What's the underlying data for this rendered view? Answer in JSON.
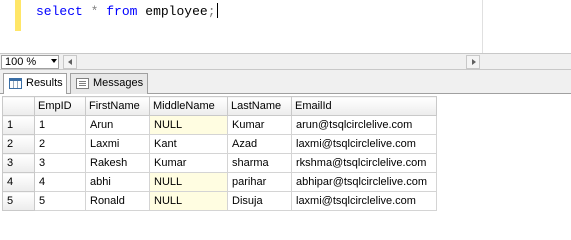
{
  "editor": {
    "tokens": {
      "select": "select",
      "star": "*",
      "from": "from",
      "table": "employee",
      "semicolon": ";"
    }
  },
  "zoom": {
    "value": "100 %"
  },
  "tabs": [
    {
      "label": "Results",
      "icon": "grid-icon",
      "active": true
    },
    {
      "label": "Messages",
      "icon": "messages-icon",
      "active": false
    }
  ],
  "grid": {
    "columns": [
      "EmpID",
      "FirstName",
      "MiddleName",
      "LastName",
      "EmailId"
    ],
    "rows": [
      {
        "n": "1",
        "EmpID": "1",
        "FirstName": "Arun",
        "MiddleName": "NULL",
        "LastName": "Kumar",
        "EmailId": "arun@tsqlcirclelive.com"
      },
      {
        "n": "2",
        "EmpID": "2",
        "FirstName": "Laxmi",
        "MiddleName": "Kant",
        "LastName": "Azad",
        "EmailId": "laxmi@tsqlcirclelive.com"
      },
      {
        "n": "3",
        "EmpID": "3",
        "FirstName": "Rakesh",
        "MiddleName": "Kumar",
        "LastName": "sharma",
        "EmailId": "rkshma@tsqlcirclelive.com"
      },
      {
        "n": "4",
        "EmpID": "4",
        "FirstName": "abhi",
        "MiddleName": "NULL",
        "LastName": "parihar",
        "EmailId": "abhipar@tsqlcirclelive.com"
      },
      {
        "n": "5",
        "EmpID": "5",
        "FirstName": "Ronald",
        "MiddleName": "NULL",
        "LastName": "Disuja",
        "EmailId": "laxmi@tsqlcirclelive.com"
      }
    ]
  },
  "colors": {
    "keyword": "#0000ff",
    "operator": "#808080",
    "null_cell_bg": "#fffde1",
    "change_bar": "#ffe667"
  }
}
